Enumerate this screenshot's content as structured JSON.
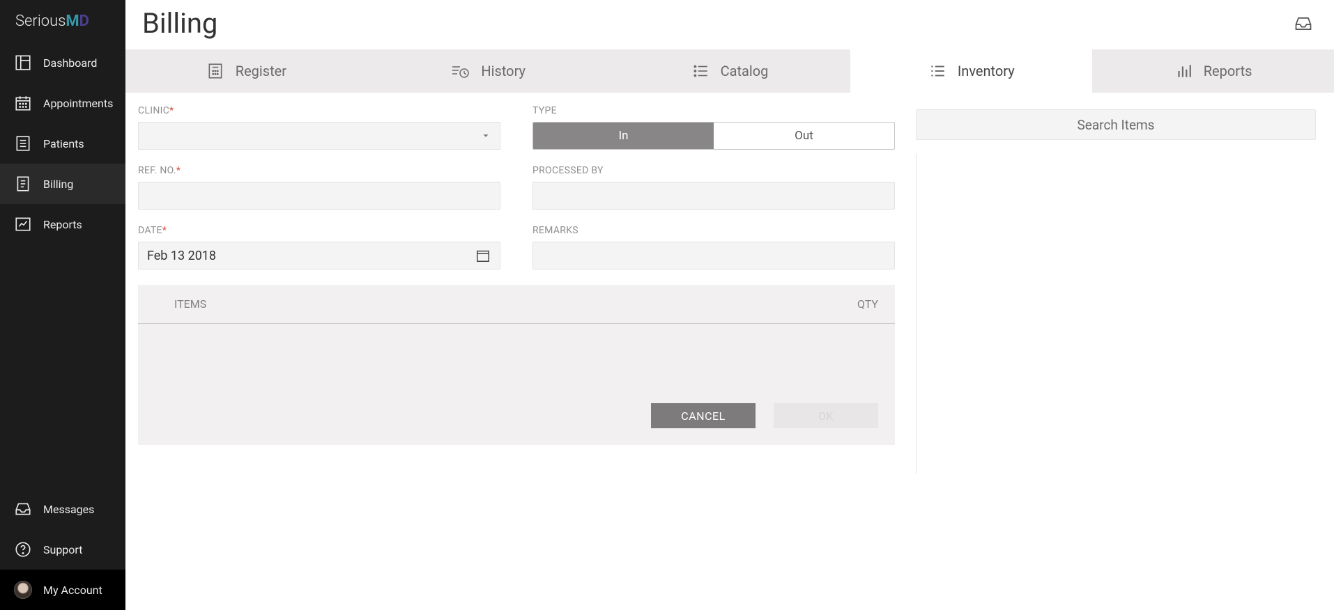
{
  "brand": {
    "name1": "Serious",
    "name2": "M",
    "name3": "D"
  },
  "sidebar": {
    "items": [
      {
        "label": "Dashboard"
      },
      {
        "label": "Appointments"
      },
      {
        "label": "Patients"
      },
      {
        "label": "Billing"
      },
      {
        "label": "Reports"
      }
    ],
    "bottom": [
      {
        "label": "Messages"
      },
      {
        "label": "Support"
      },
      {
        "label": "My Account"
      }
    ]
  },
  "page": {
    "title": "Billing"
  },
  "tabs": [
    {
      "label": "Register"
    },
    {
      "label": "History"
    },
    {
      "label": "Catalog"
    },
    {
      "label": "Inventory"
    },
    {
      "label": "Reports"
    }
  ],
  "form": {
    "clinic_label": "CLINIC",
    "type_label": "TYPE",
    "type_in": "In",
    "type_out": "Out",
    "refno_label": "REF. NO.",
    "processedby_label": "PROCESSED BY",
    "date_label": "DATE",
    "date_value": "Feb 13 2018",
    "remarks_label": "REMARKS"
  },
  "table": {
    "items_col": "ITEMS",
    "qty_col": "QTY"
  },
  "buttons": {
    "cancel": "CANCEL",
    "ok": "OK"
  },
  "search": {
    "placeholder": "Search Items"
  }
}
